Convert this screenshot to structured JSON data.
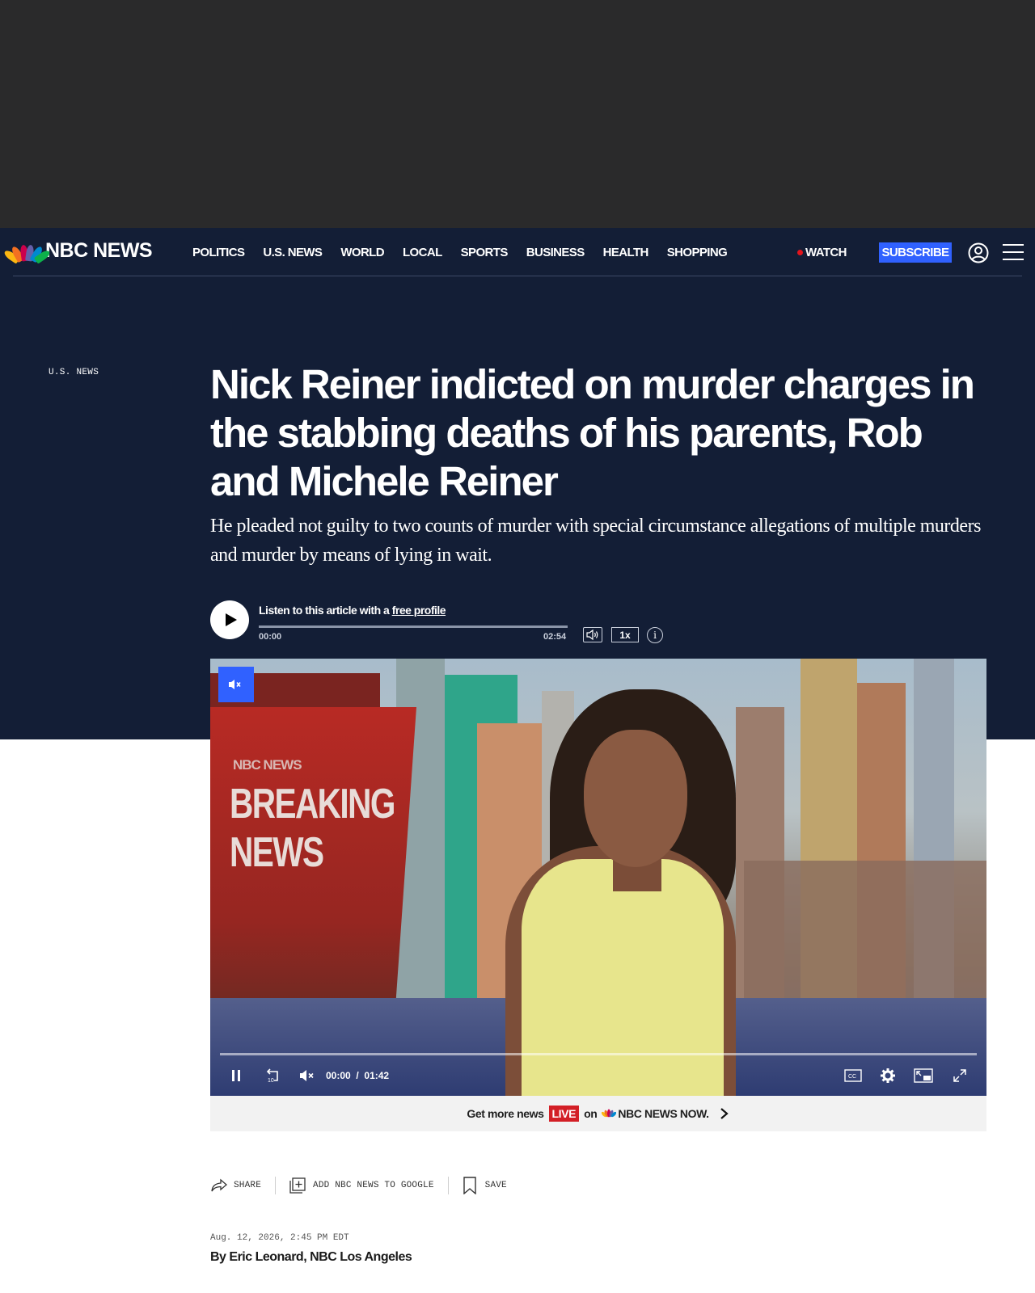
{
  "nav": {
    "logo_text": "NBC NEWS",
    "links": [
      "POLITICS",
      "U.S. NEWS",
      "WORLD",
      "LOCAL",
      "SPORTS",
      "BUSINESS",
      "HEALTH",
      "SHOPPING"
    ],
    "watch_label": "WATCH",
    "subscribe_label": "SUBSCRIBE",
    "account_icon": "account-circle-icon",
    "menu_icon": "hamburger-menu-icon",
    "accent_color": "#3061ff",
    "live_dot_color": "#e3141c"
  },
  "article": {
    "section": "U.S. NEWS",
    "headline": "Nick Reiner indicted on murder charges in the stabbing deaths of his parents, Rob and Michele Reiner",
    "dek": "He pleaded not guilty to two counts of murder with special circumstance allegations of multiple murders and murder by means of lying in wait.",
    "dateline": "Aug. 12, 2026, 2:45 PM EDT",
    "byline": "By Eric Leonard, NBC Los Angeles"
  },
  "audio": {
    "prompt_prefix": "Listen to this article with a ",
    "prompt_link": "free profile",
    "time_current": "00:00",
    "time_total": "02:54",
    "speed": "1x",
    "progress": 0,
    "info_glyph": "i"
  },
  "video": {
    "brand_text": "NBC NEWS",
    "breaking_text": "BREAKING NEWS",
    "time_current": "00:00",
    "time_separator": "/",
    "time_total": "01:42",
    "progress": 0,
    "muted": true,
    "cc_label": "CC"
  },
  "promo": {
    "prefix": "Get more news",
    "live": "LIVE",
    "middle": "on",
    "brand": "NBC NEWS NOW."
  },
  "share_bar": {
    "share_label": "SHARE",
    "google_label": "ADD NBC NEWS TO GOOGLE",
    "save_label": "SAVE"
  }
}
